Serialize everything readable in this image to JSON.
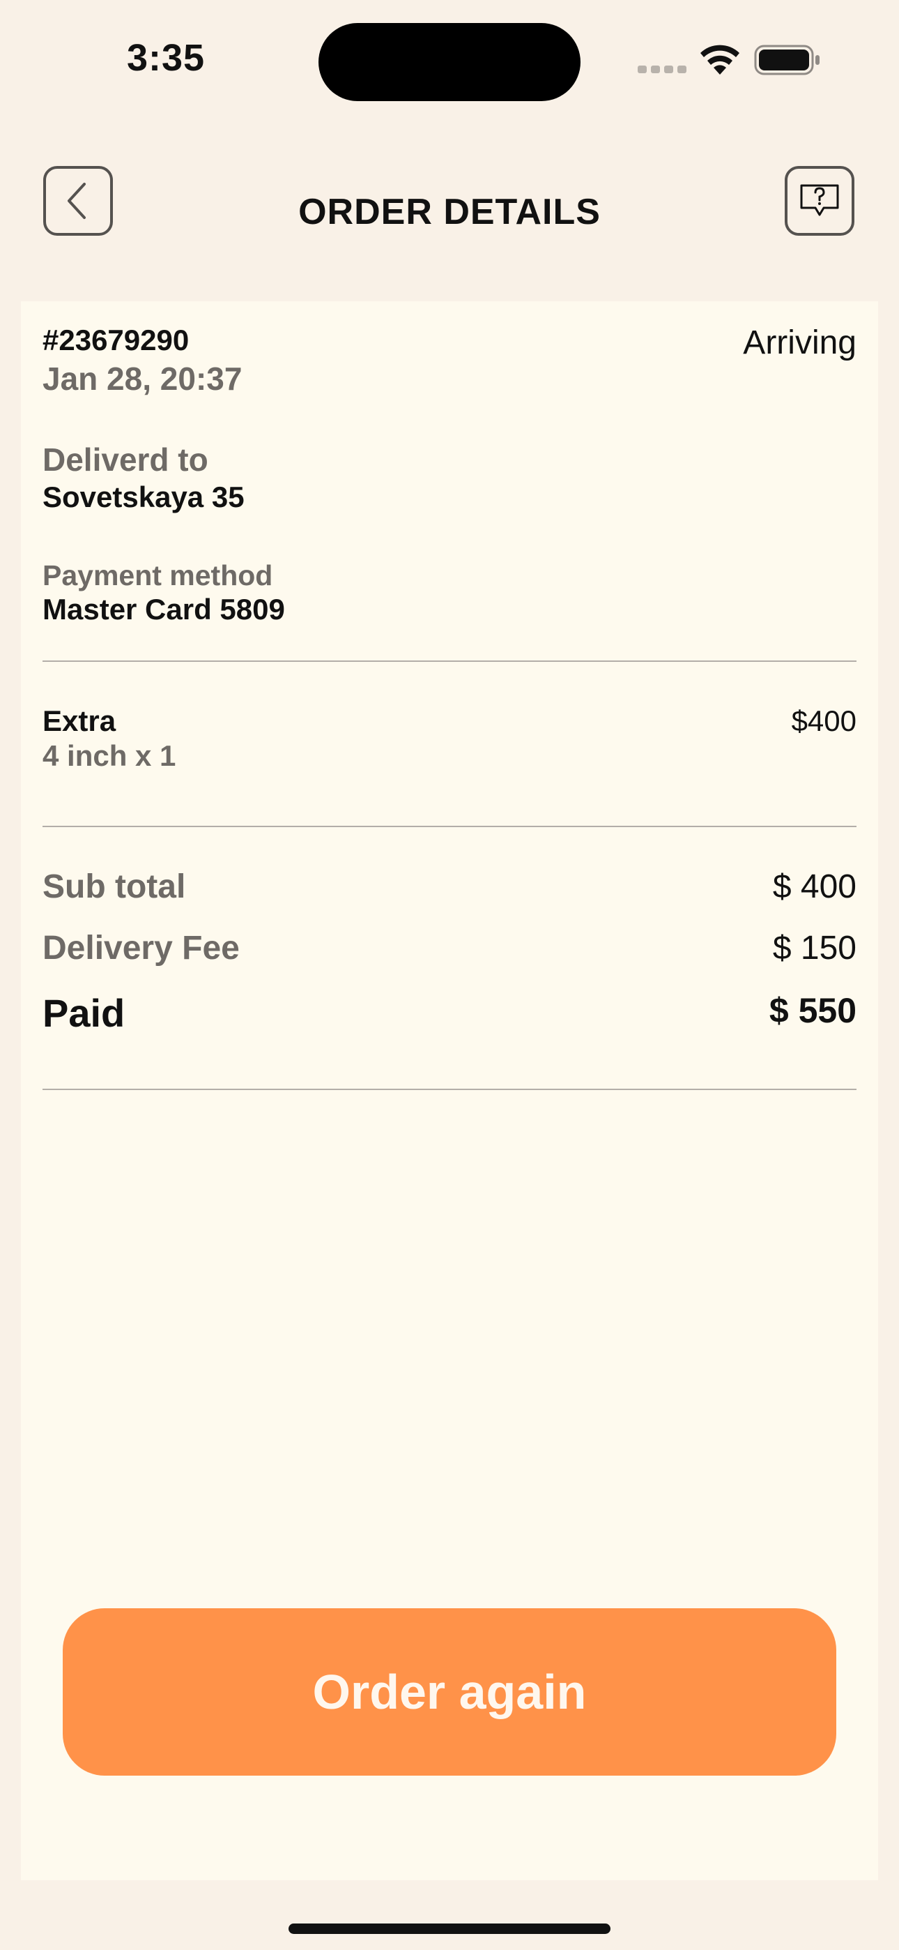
{
  "status_bar": {
    "time": "3:35"
  },
  "header": {
    "title": "ORDER DETAILS",
    "back_icon": "chevron-left-icon",
    "help_icon": "help-chat-icon"
  },
  "order": {
    "id": "#23679290",
    "date": "Jan 28, 20:37",
    "status": "Arriving",
    "delivered_label": "Deliverd to",
    "delivered_value": "Sovetskaya 35",
    "payment_label": "Payment method",
    "payment_value": "Master Card 5809"
  },
  "items": [
    {
      "name": "Extra",
      "detail": "4 inch x 1",
      "price": "$400"
    }
  ],
  "summary": {
    "subtotal_label": "Sub total",
    "subtotal_value": "$ 400",
    "delivery_label": "Delivery Fee",
    "delivery_value": "$ 150",
    "paid_label": "Paid",
    "paid_value": "$ 550"
  },
  "actions": {
    "order_again_label": "Order again"
  },
  "colors": {
    "background": "#f9f1e7",
    "card": "#fefaee",
    "accent": "#ff9249"
  }
}
